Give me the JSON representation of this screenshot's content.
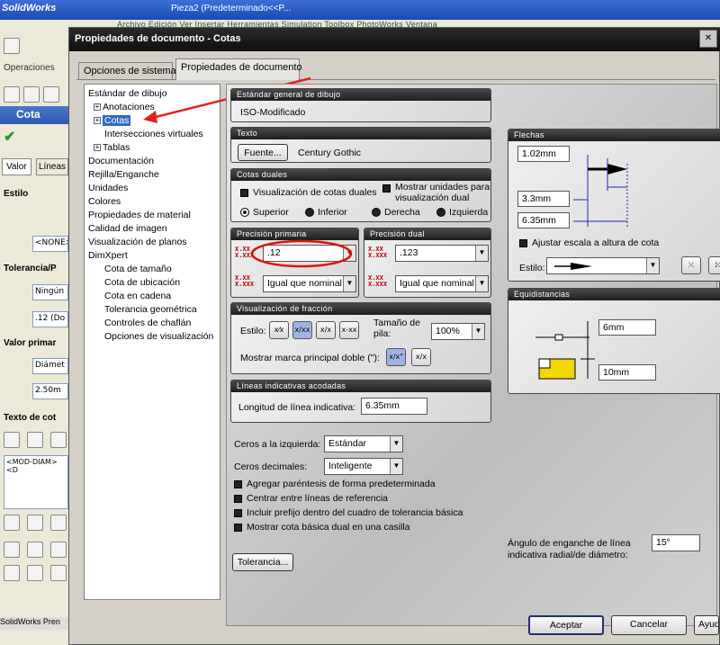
{
  "bg": {
    "app_logo": "SolidWorks",
    "doc_tab": "Pieza2 (Predeterminado<<P...",
    "menu_items": "Archivo   Edición   Ver   Insertar   Herramientas   Simulation   Toolbox   PhotoWorks   Ventana",
    "ops_label": "Operaciones",
    "pm_title": "Cota",
    "pm_tabs": [
      "Valor",
      "Líneas"
    ],
    "estilo": "Estilo",
    "none_field": "<NONE>",
    "tolerancia": "Tolerancia/P",
    "ningun": "Ningún",
    "dot12": ".12 (Do",
    "valor_primario": "Valor primar",
    "diam": "Diámet",
    "val250": "2.50m",
    "texto_cota": "Texto de cot",
    "mod_diam": "<MOD-DIAM><D",
    "status": "SolidWorks Pren"
  },
  "dialog": {
    "title": "Propiedades de documento - Cotas",
    "tabs": [
      "Opciones de sistema",
      "Propiedades de documento"
    ],
    "buttons": {
      "accept": "Aceptar",
      "cancel": "Cancelar",
      "help": "Ayuda"
    }
  },
  "tree": {
    "items": [
      {
        "label": "Estándar de dibujo",
        "indent": 0,
        "exp": ""
      },
      {
        "label": "Anotaciones",
        "indent": 1,
        "exp": "+"
      },
      {
        "label": "Cotas",
        "indent": 1,
        "exp": "+",
        "selected": true
      },
      {
        "label": "Intersecciones virtuales",
        "indent": 2,
        "exp": ""
      },
      {
        "label": "Tablas",
        "indent": 1,
        "exp": "+"
      },
      {
        "label": "Documentación",
        "indent": 0,
        "exp": ""
      },
      {
        "label": "Rejilla/Enganche",
        "indent": 0,
        "exp": ""
      },
      {
        "label": "Unidades",
        "indent": 0,
        "exp": ""
      },
      {
        "label": "Colores",
        "indent": 0,
        "exp": ""
      },
      {
        "label": "Propiedades de material",
        "indent": 0,
        "exp": ""
      },
      {
        "label": "Calidad de imagen",
        "indent": 0,
        "exp": ""
      },
      {
        "label": "Visualización de planos",
        "indent": 0,
        "exp": ""
      },
      {
        "label": "DimXpert",
        "indent": 0,
        "exp": ""
      },
      {
        "label": "Cota de tamaño",
        "indent": 2,
        "exp": ""
      },
      {
        "label": "Cota de ubicación",
        "indent": 2,
        "exp": ""
      },
      {
        "label": "Cota en cadena",
        "indent": 2,
        "exp": ""
      },
      {
        "label": "Tolerancia geométrica",
        "indent": 2,
        "exp": ""
      },
      {
        "label": "Controles de chaflán",
        "indent": 2,
        "exp": ""
      },
      {
        "label": "Opciones de visualización",
        "indent": 2,
        "exp": ""
      }
    ]
  },
  "estandar": {
    "header": "Estándar general de dibujo",
    "value": "ISO-Modificado"
  },
  "texto": {
    "header": "Texto",
    "font_button": "Fuente...",
    "font_name": "Century Gothic"
  },
  "duales": {
    "header": "Cotas duales",
    "show_dual": "Visualización de cotas duales",
    "show_units": "Mostrar unidades para visualización dual",
    "radios": [
      "Superior",
      "Inferior",
      "Derecha",
      "Izquierda"
    ]
  },
  "precision_primaria": {
    "header": "Precisión primaria",
    "value": ".12",
    "tol": "Igual que nominal",
    "icon_top": "X.XX",
    "icon_bottom": "X.XXX"
  },
  "precision_dual": {
    "header": "Precisión dual",
    "value": ".123",
    "tol": "Igual que nominal",
    "icon_top": "X.XX",
    "icon_bottom": "X.XXX"
  },
  "fraccion": {
    "header": "Visualización de fracción",
    "estilo": "Estilo:",
    "tamano": "Tamaño de pila:",
    "pila": "100%",
    "doble": "Mostrar marca principal doble (\"):",
    "style_icons": [
      "x⁄x",
      "x/xx",
      "x/x",
      "x-xx"
    ],
    "double_icons": [
      "x/x\"",
      "x/x"
    ]
  },
  "lineas": {
    "header": "Líneas indicativas acodadas",
    "label": "Longitud de línea indicativa:",
    "value": "6.35mm"
  },
  "flechas": {
    "header": "Flechas",
    "v1": "1.02mm",
    "v2": "3.3mm",
    "v3": "6.35mm",
    "scale": "Ajustar escala a altura de cota",
    "estilo": "Estilo:"
  },
  "equidistancias": {
    "header": "Equidistancias",
    "v1": "6mm",
    "v2": "10mm"
  },
  "ceros": {
    "izq_label": "Ceros a la izquierda:",
    "izq": "Estándar",
    "dec_label": "Ceros decimales:",
    "dec": "Inteligente"
  },
  "checks": [
    "Agregar paréntesis de forma predeterminada",
    "Centrar entre líneas de referencia",
    "Incluir prefijo dentro del cuadro de tolerancia básica",
    "Mostrar cota básica dual en una casilla"
  ],
  "angulo": {
    "label1": "Ángulo de enganche de línea",
    "label2": "indicativa radial/de diámetro:",
    "value": "15°"
  },
  "tolerancia_button": "Tolerancia..."
}
